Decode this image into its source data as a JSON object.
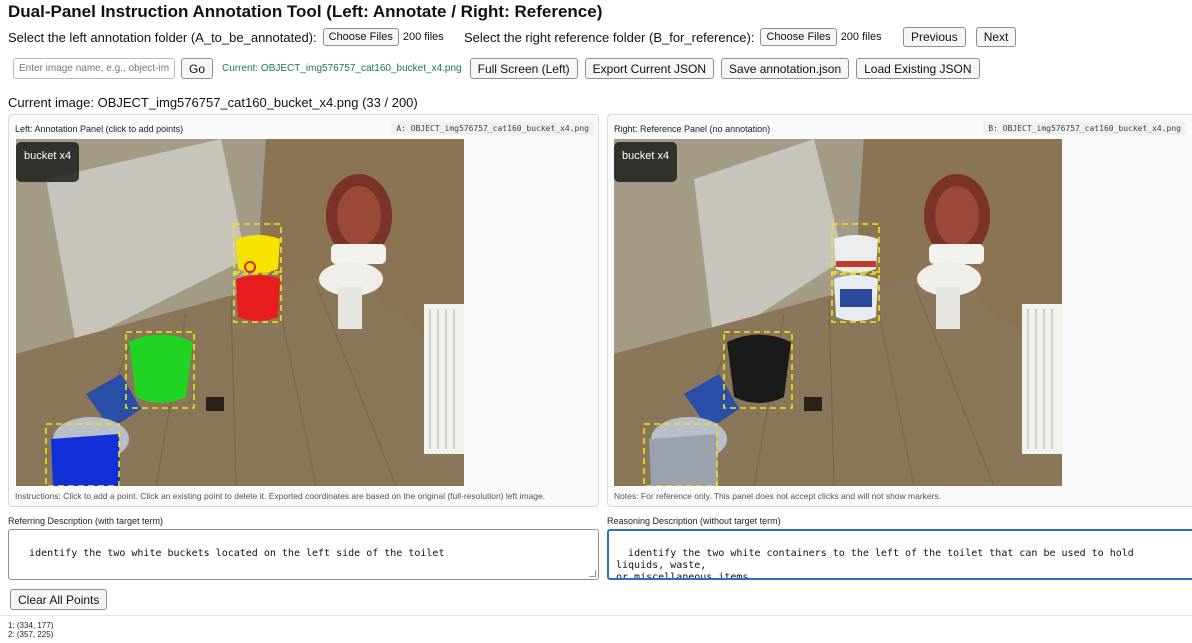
{
  "title": "Dual-Panel Instruction Annotation Tool (Left: Annotate / Right: Reference)",
  "folders": {
    "left_label": "Select the left annotation folder (A_to_be_annotated):",
    "left_button": "Choose Files",
    "left_count": "200 files",
    "right_label": "Select the right reference folder (B_for_reference):",
    "right_button": "Choose Files",
    "right_count": "200 files"
  },
  "nav": {
    "previous": "Previous",
    "next": "Next"
  },
  "toolbar": {
    "search_placeholder": "Enter image name, e.g., object-image.png",
    "go": "Go",
    "current": "Current: OBJECT_img576757_cat160_bucket_x4.png",
    "fullscreen": "Full Screen (Left)",
    "export": "Export Current JSON",
    "save": "Save annotation.json",
    "load": "Load Existing JSON"
  },
  "current_image": "Current image: OBJECT_img576757_cat160_bucket_x4.png  (33 / 200)",
  "left_panel": {
    "title": "Left: Annotation Panel (click to add points)",
    "file": "A: OBJECT_img576757_cat160_bucket_x4.png",
    "image_tag": "bucket x4",
    "instructions": "Instructions: Click to add a point. Click an existing point to delete it. Exported coordinates are based on the original (full-resolution) left image."
  },
  "right_panel": {
    "title": "Right: Reference Panel (no annotation)",
    "file": "B: OBJECT_img576757_cat160_bucket_x4.png",
    "image_tag": "bucket x4",
    "notes": "Notes: For reference only. This panel does not accept clicks and will not show markers."
  },
  "referring": {
    "label": "Referring Description (with target term)",
    "text": "identify the two white buckets located on the left side of the toilet"
  },
  "reasoning": {
    "label": "Reasoning Description (without target term)",
    "text": "identify the two white containers to the left of the toilet that can be used to hold liquids, waste,\nor miscellaneous items"
  },
  "clear_button": "Clear All Points",
  "points": [
    "1: (334, 177)",
    "2: (357, 225)"
  ],
  "colors": {
    "accent_green": "#1a7a4a",
    "focus_blue": "#2c6fd1",
    "mask_yellow": "#f6e400",
    "mask_red": "#e81c1c",
    "mask_green": "#22d422",
    "mask_blue": "#1230d8",
    "bbox_dash": "#f2e41a"
  },
  "icons": [
    "file-picker",
    "resize-grip-icon"
  ]
}
